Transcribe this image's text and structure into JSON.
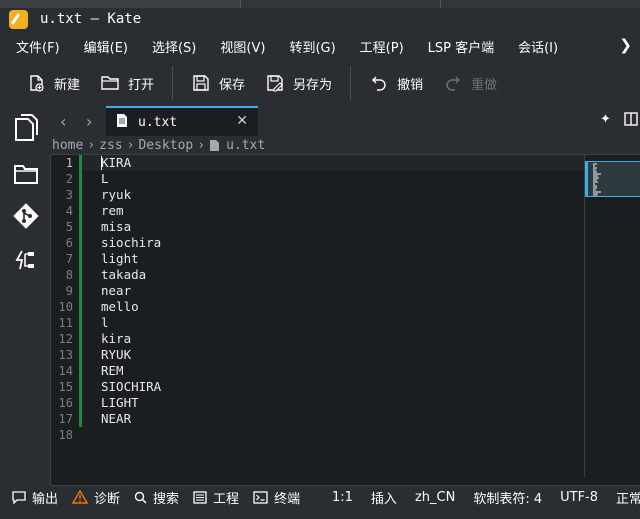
{
  "window": {
    "title": "u.txt — Kate"
  },
  "menu": {
    "items": [
      "文件(F)",
      "编辑(E)",
      "选择(S)",
      "视图(V)",
      "转到(G)",
      "工程(P)",
      "LSP 客户端",
      "会话(I)"
    ],
    "more_icon": "chevron-right-icon"
  },
  "toolbar": {
    "new_label": "新建",
    "open_label": "打开",
    "save_label": "保存",
    "save_as_label": "另存为",
    "undo_label": "撤销",
    "redo_label": "重做"
  },
  "tab": {
    "label": "u.txt",
    "close_glyph": "✕"
  },
  "breadcrumb": {
    "parts": [
      "home",
      "zss",
      "Desktop",
      "u.txt"
    ]
  },
  "editor": {
    "lines": [
      "KIRA",
      "L",
      "ryuk",
      "rem",
      "misa",
      "siochira",
      "light",
      "takada",
      "near",
      "mello",
      "l",
      "kira",
      "RYUK",
      "REM",
      "SIOCHIRA",
      "LIGHT",
      "NEAR",
      ""
    ],
    "line_numbers": [
      "1",
      "2",
      "3",
      "4",
      "5",
      "6",
      "7",
      "8",
      "9",
      "10",
      "11",
      "12",
      "13",
      "14",
      "15",
      "16",
      "17",
      "18"
    ],
    "current_line": 1
  },
  "statusbar": {
    "output_label": "输出",
    "diagnostics_label": "诊断",
    "search_label": "搜索",
    "project_label": "工程",
    "terminal_label": "终端",
    "cursor_pos": "1:1",
    "mode": "插入",
    "language": "zh_CN",
    "indent": "软制表符: 4",
    "encoding": "UTF-8",
    "eol": "正常"
  },
  "colors": {
    "accent": "#3daee9",
    "modified_bar": "#1f8a3d",
    "app_icon": "#f2b01e",
    "warning": "#f67400"
  }
}
